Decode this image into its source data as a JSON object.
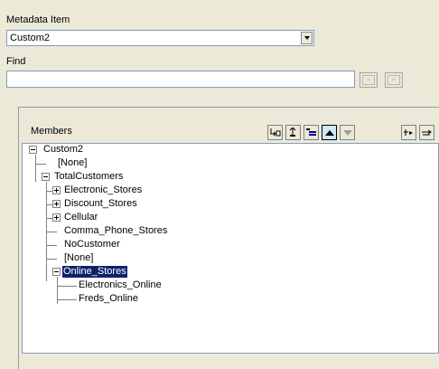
{
  "metadata_item": {
    "label": "Metadata Item",
    "value": "Custom2"
  },
  "find": {
    "label": "Find",
    "value": ""
  },
  "members": {
    "label": "Members",
    "tree": [
      {
        "label": "Custom2",
        "expander": "minus"
      },
      {
        "label": "[None]"
      },
      {
        "label": "TotalCustomers",
        "expander": "minus"
      },
      {
        "label": "Electronic_Stores",
        "expander": "plus"
      },
      {
        "label": "Discount_Stores",
        "expander": "plus"
      },
      {
        "label": "Cellular",
        "expander": "plus"
      },
      {
        "label": "Comma_Phone_Stores"
      },
      {
        "label": "NoCustomer"
      },
      {
        "label": "[None]"
      },
      {
        "label": "Online_Stores",
        "expander": "minus",
        "selected": true
      },
      {
        "label": "Electronics_Online"
      },
      {
        "label": "Freds_Online"
      }
    ]
  },
  "toolbar_icons": [
    "insert-child-icon",
    "insert-sibling-icon",
    "promote-icon",
    "move-up-icon",
    "move-down-icon",
    "expand-icon",
    "collapse-icon"
  ],
  "colors": {
    "selection": "#0a246a",
    "window": "#ece9d8"
  }
}
